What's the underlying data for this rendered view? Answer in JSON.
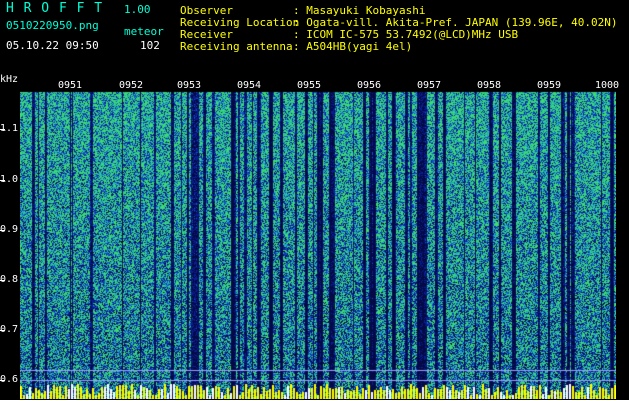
{
  "app": {
    "name": "H R O F F T",
    "version": "1.00"
  },
  "file": {
    "name": "0510220950.png",
    "datetime": "05.10.22 09:50"
  },
  "mode": {
    "label": "meteor",
    "count": "102"
  },
  "info": [
    {
      "key": "Observer",
      "value": ": Masayuki Kobayashi"
    },
    {
      "key": "Receiving Location",
      "value": ": Ogata-vill. Akita-Pref. JAPAN (139.96E, 40.02N)"
    },
    {
      "key": "Receiver",
      "value": ": ICOM IC-575 53.7492(@LCD)MHz USB"
    },
    {
      "key": "Receiving antenna",
      "value": ": A504HB(yagi 4el)"
    }
  ],
  "axis": {
    "unit": "kHz",
    "freq_labels": [
      "1.1",
      "1.0",
      "0.9",
      "0.8",
      "0.7",
      "0.6"
    ],
    "time_labels": [
      "0951",
      "0952",
      "0953",
      "0954",
      "0955",
      "0956",
      "0957",
      "0958",
      "0959",
      "1000"
    ]
  },
  "colors": {
    "header": "#00ffd8",
    "meta": "#ffff00",
    "text": "#ffffff",
    "background": "#000000"
  }
}
